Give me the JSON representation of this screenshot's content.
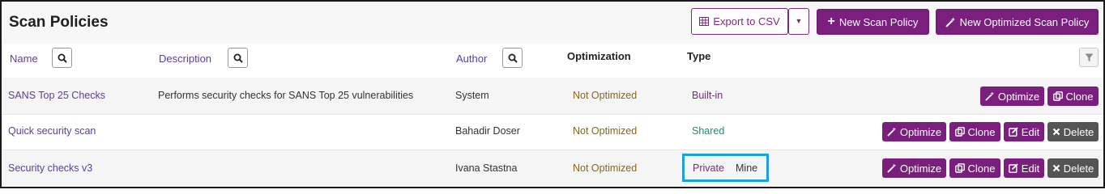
{
  "header": {
    "title": "Scan Policies",
    "export_label": "Export to CSV",
    "new_scan_policy_label": "New Scan Policy",
    "new_optimized_label": "New Optimized Scan Policy"
  },
  "columns": {
    "name": "Name",
    "description": "Description",
    "author": "Author",
    "optimization": "Optimization",
    "type": "Type"
  },
  "rows": [
    {
      "name": "SANS Top 25 Checks",
      "description": "Performs security checks for SANS Top 25 vulnerabilities",
      "author": "System",
      "optimization": "Not Optimized",
      "type": "Built-in",
      "type_extra": "",
      "actions": [
        "Optimize",
        "Clone"
      ]
    },
    {
      "name": "Quick security scan",
      "description": "",
      "author": "Bahadir Doser",
      "optimization": "Not Optimized",
      "type": "Shared",
      "type_extra": "",
      "actions": [
        "Optimize",
        "Clone",
        "Edit",
        "Delete"
      ]
    },
    {
      "name": "Security checks v3",
      "description": "",
      "author": "Ivana Stastna",
      "optimization": "Not Optimized",
      "type": "Private",
      "type_extra": "Mine",
      "actions": [
        "Optimize",
        "Clone",
        "Edit",
        "Delete"
      ]
    }
  ],
  "colors": {
    "accent_purple": "#7a1f7d",
    "delete_gray": "#545454",
    "highlight_blue": "#17a5d6"
  },
  "icons": {
    "export": "table-icon",
    "dropdown": "caret-down-icon",
    "new_policy": "plus-icon",
    "new_optimized": "magic-wand-icon",
    "column_search": "search-icon",
    "filter": "filter-icon",
    "optimize": "magic-wand-icon",
    "clone": "clone-icon",
    "edit": "edit-icon",
    "delete": "times-icon"
  }
}
